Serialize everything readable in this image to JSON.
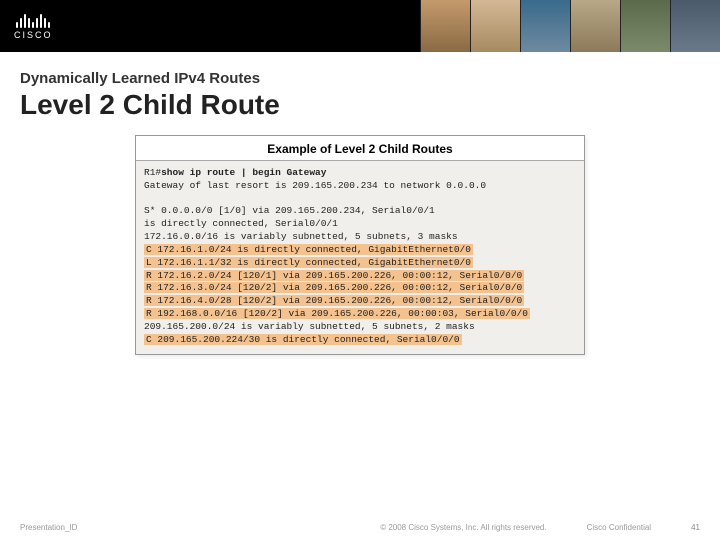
{
  "brand": "CISCO",
  "kicker": "Dynamically Learned IPv4 Routes",
  "title": "Level 2 Child Route",
  "figure_caption": "Example of Level 2 Child Routes",
  "terminal": {
    "prompt": "R1#",
    "cmd": "show ip route | begin Gateway",
    "line_gw": "Gateway of last resort is 209.165.200.234 to network 0.0.0.0",
    "line_s": "S*    0.0.0.0/0 [1/0] via 209.165.200.234, Serial0/0/1",
    "line_sconn": "               is directly connected, Serial0/0/1",
    "line_172sum": "      172.16.0.0/16 is variably subnetted, 5 subnets, 3 masks",
    "line_c1": "C        172.16.1.0/24 is directly connected, GigabitEthernet0/0",
    "line_l1": "L        172.16.1.1/32 is directly connected, GigabitEthernet0/0",
    "line_r1": "R        172.16.2.0/24 [120/1] via 209.165.200.226, 00:00:12, Serial0/0/0",
    "line_r2": "R        172.16.3.0/24 [120/2] via 209.165.200.226, 00:00:12, Serial0/0/0",
    "line_r3": "R        172.16.4.0/28 [120/2] via 209.165.200.226, 00:00:12, Serial0/0/0",
    "line_r4": "R     192.168.0.0/16 [120/2] via 209.165.200.226, 00:00:03, Serial0/0/0",
    "line_209sum": "      209.165.200.0/24 is variably subnetted, 5 subnets, 2 masks",
    "line_c2": "C        209.165.200.224/30 is directly connected, Serial0/0/0"
  },
  "footer": {
    "left": "Presentation_ID",
    "center": "© 2008 Cisco Systems, Inc. All rights reserved.",
    "conf": "Cisco Confidential",
    "page": "41"
  }
}
